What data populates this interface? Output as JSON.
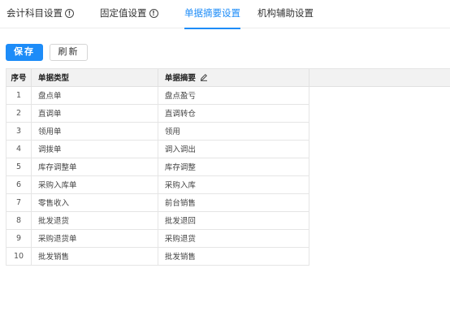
{
  "tabs": [
    {
      "label": "会计科目设置",
      "has_info": true,
      "active": false
    },
    {
      "label": "固定值设置",
      "has_info": true,
      "active": false
    },
    {
      "label": "单据摘要设置",
      "has_info": false,
      "active": true
    },
    {
      "label": "机构辅助设置",
      "has_info": false,
      "active": false
    }
  ],
  "toolbar": {
    "save_label": "保存",
    "refresh_label": "刷新"
  },
  "table": {
    "headers": {
      "index": "序号",
      "type": "单据类型",
      "summary": "单据摘要"
    },
    "rows": [
      {
        "index": "1",
        "type": "盘点单",
        "summary": "盘点盈亏"
      },
      {
        "index": "2",
        "type": "直调单",
        "summary": "直调转仓"
      },
      {
        "index": "3",
        "type": "领用单",
        "summary": "领用"
      },
      {
        "index": "4",
        "type": "调拨单",
        "summary": "调入调出"
      },
      {
        "index": "5",
        "type": "库存调整单",
        "summary": "库存调整"
      },
      {
        "index": "6",
        "type": "采购入库单",
        "summary": "采购入库"
      },
      {
        "index": "7",
        "type": "零售收入",
        "summary": "前台销售"
      },
      {
        "index": "8",
        "type": "批发退货",
        "summary": "批发退回"
      },
      {
        "index": "9",
        "type": "采购退货单",
        "summary": "采购退货"
      },
      {
        "index": "10",
        "type": "批发销售",
        "summary": "批发销售"
      }
    ]
  },
  "colors": {
    "accent": "#1d8cf8",
    "header_bg": "#f2f2f2",
    "border": "#e5e5e5"
  }
}
